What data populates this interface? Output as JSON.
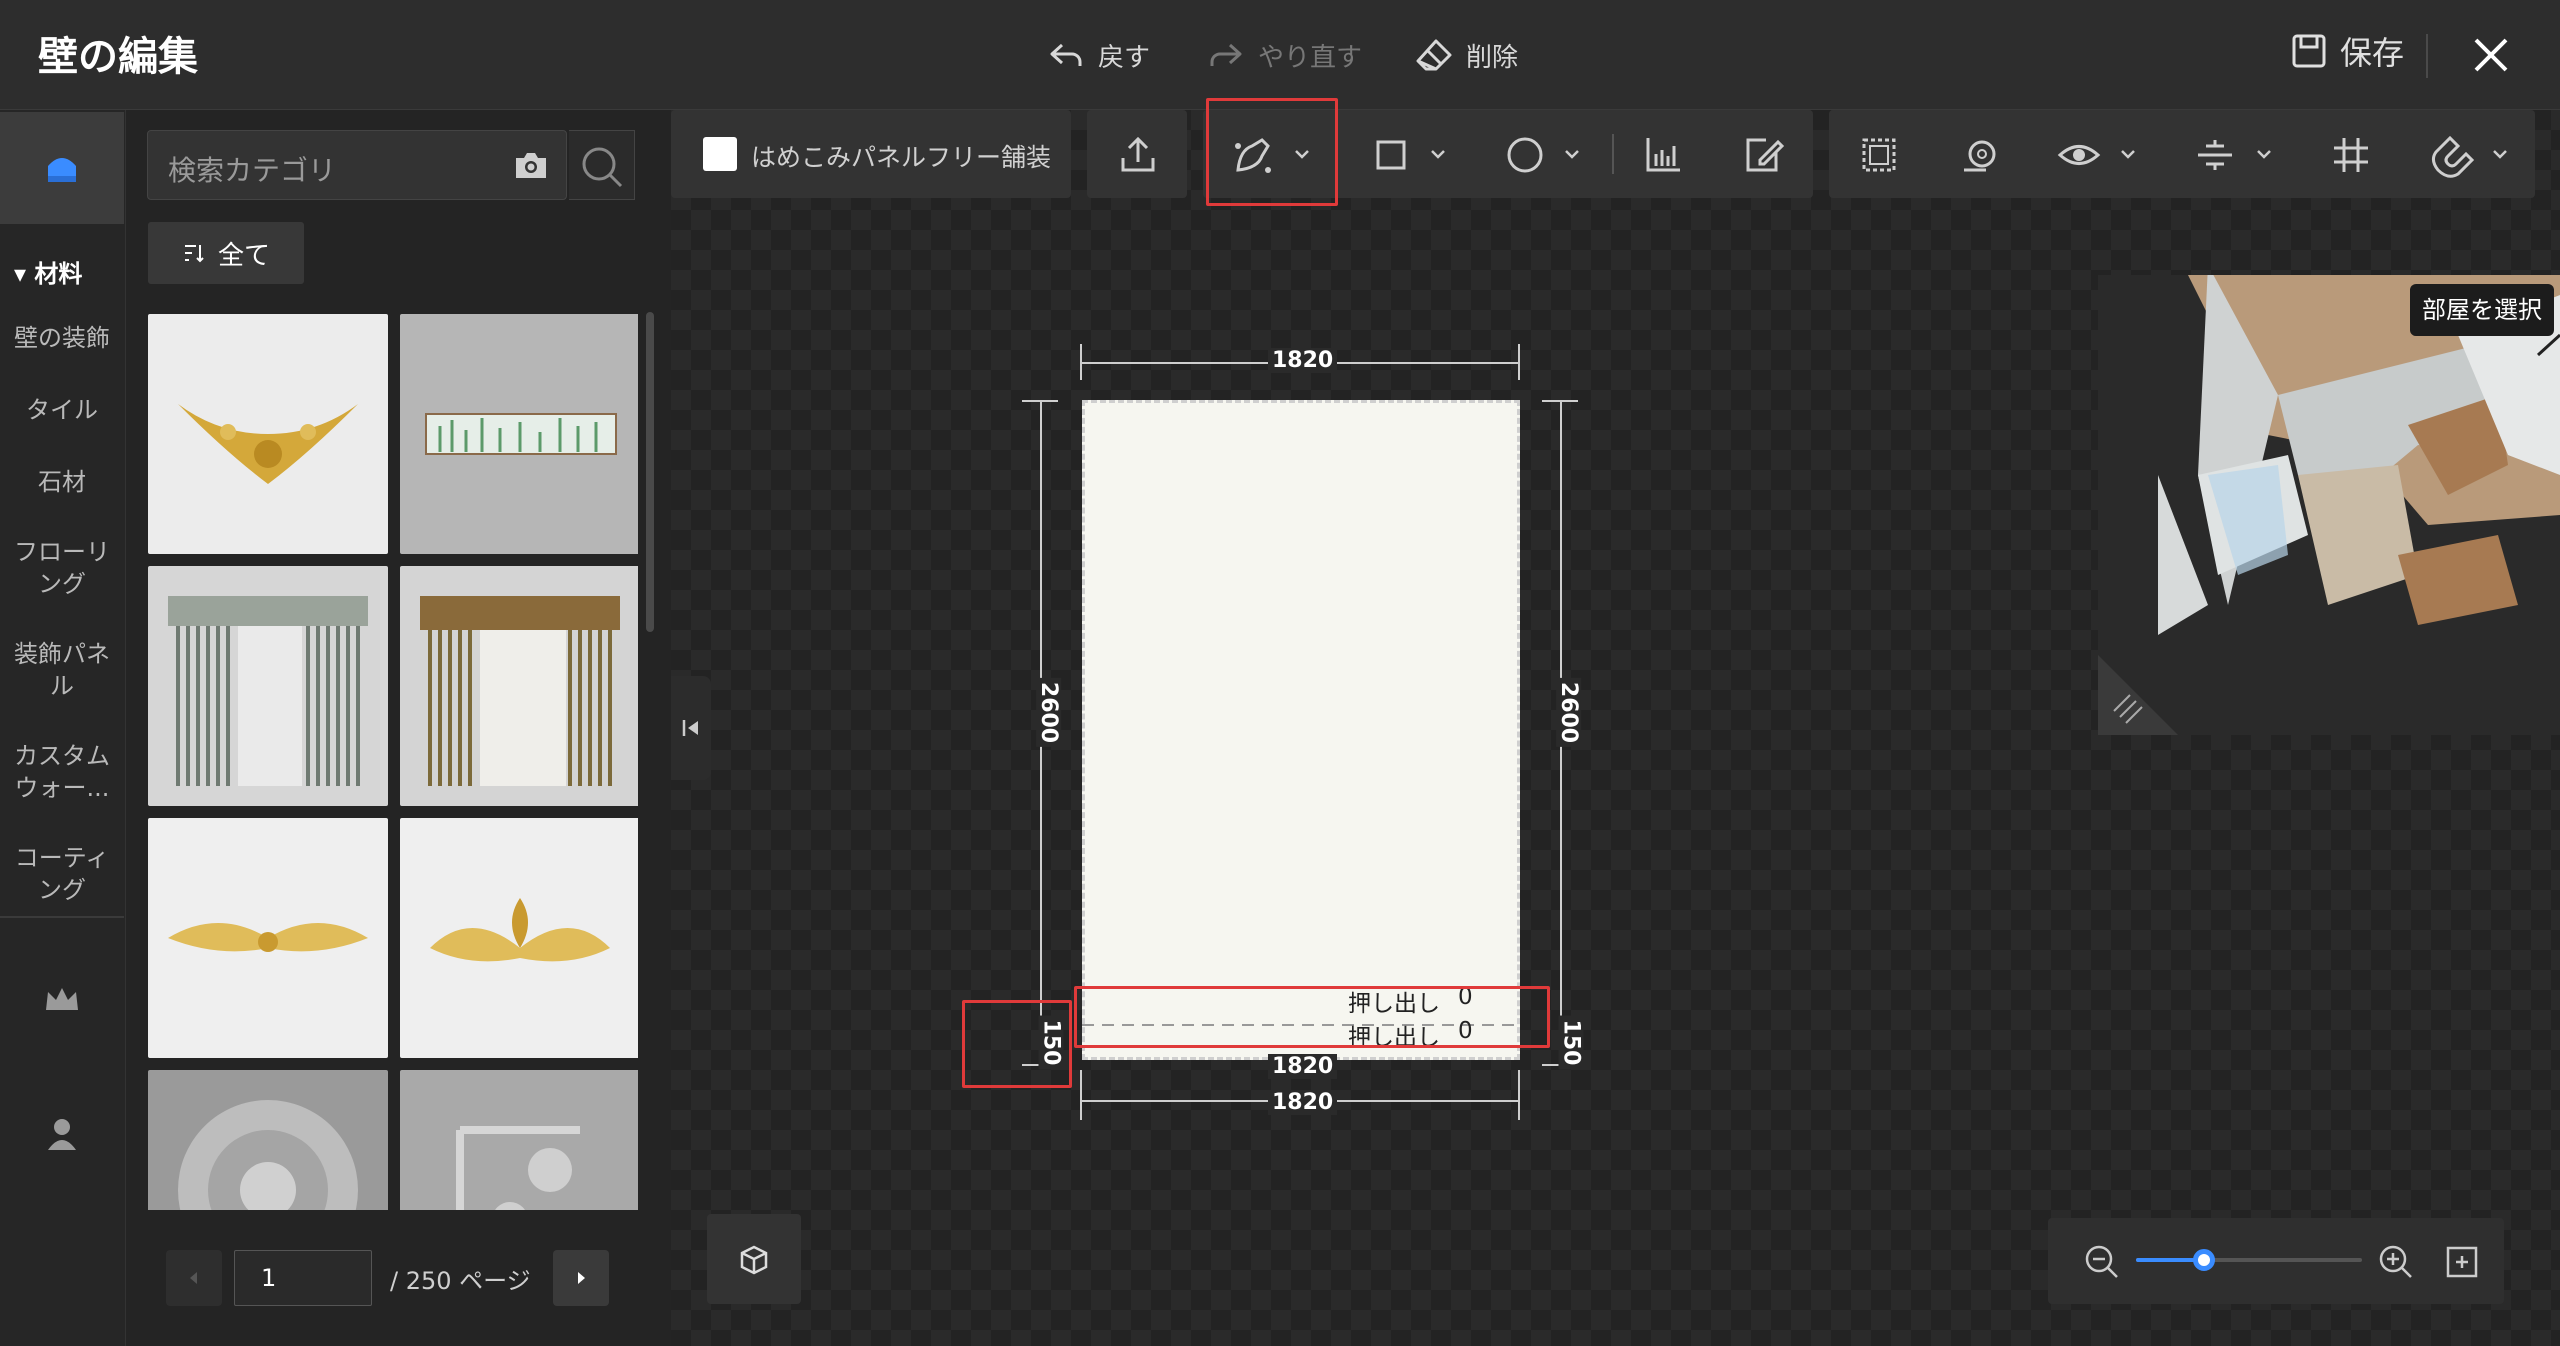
{
  "header": {
    "title": "壁の編集",
    "undo_label": "戻す",
    "redo_label": "やり直す",
    "delete_label": "削除",
    "save_label": "保存"
  },
  "rail": {
    "section_label": "材料",
    "items": [
      {
        "label": "壁の装飾"
      },
      {
        "label": "タイル"
      },
      {
        "label": "石材"
      },
      {
        "label": "フローリング"
      },
      {
        "label": "装飾パネル"
      },
      {
        "label": "カスタムウォー..."
      },
      {
        "label": "コーティング"
      }
    ]
  },
  "catalog": {
    "search_placeholder": "検索カテゴリ",
    "filter_label": "全て",
    "page_value": "1",
    "page_total": "/ 250 ページ"
  },
  "toolbar": {
    "checkbox_label": "はめこみパネルフリー舗装"
  },
  "preview": {
    "room_select_label": "部屋を選択"
  },
  "wall": {
    "width_top": "1820",
    "height_left": "2600",
    "height_right": "2600",
    "base_left": "150",
    "base_right": "150",
    "width_mid": "1820",
    "width_bottom": "1820",
    "extrude_label_1": "押し出し",
    "extrude_value_1": "0",
    "extrude_label_2": "押し出し",
    "extrude_value_2": "0"
  },
  "zoom": {
    "level": 0.3
  },
  "colors": {
    "accent": "#3a8cff",
    "highlight": "#e03a3a"
  }
}
